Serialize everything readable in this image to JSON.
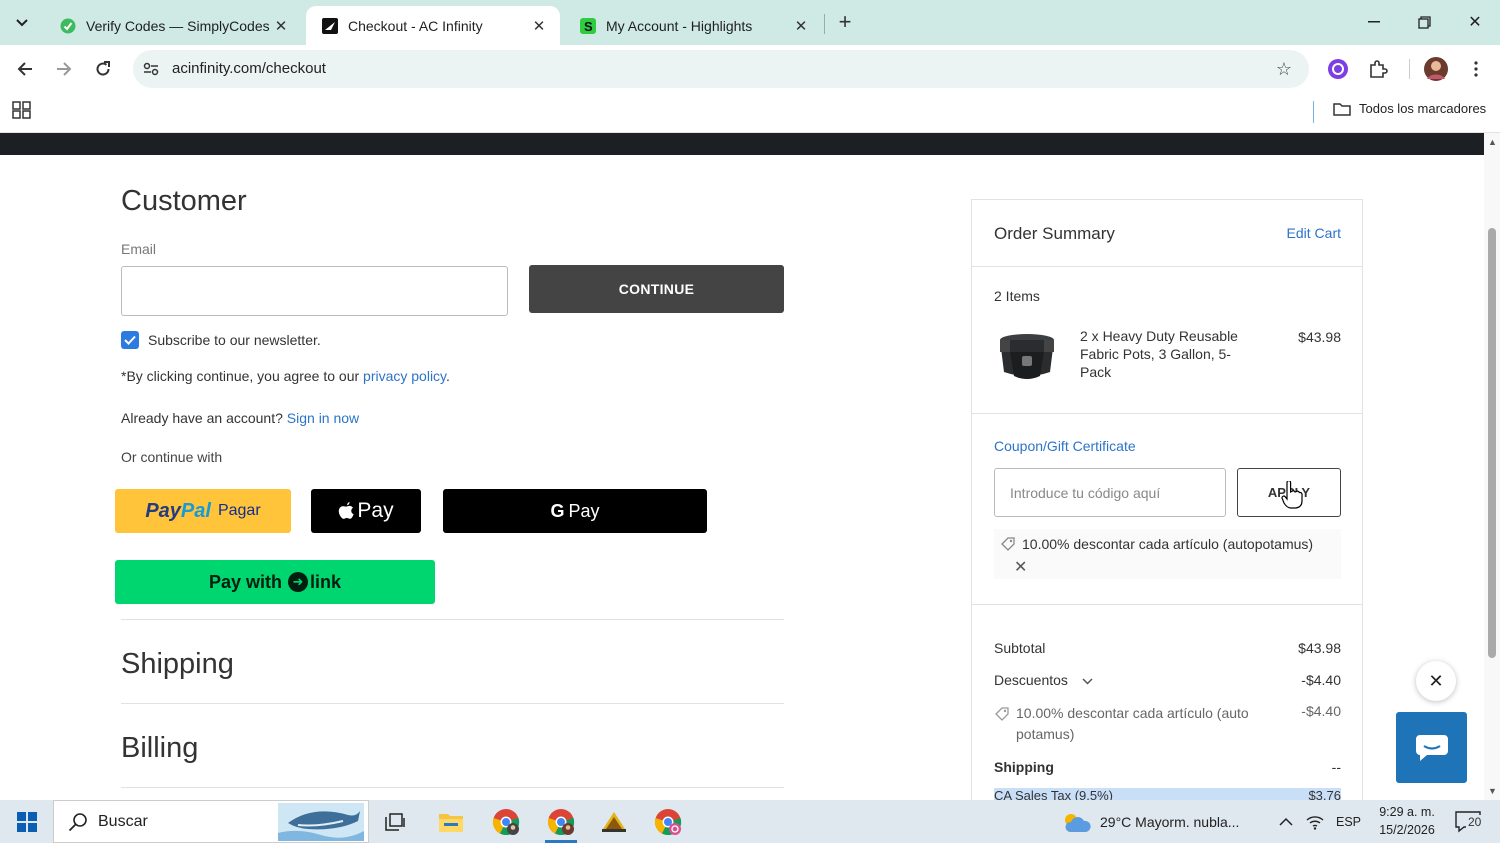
{
  "browser": {
    "tabs": [
      {
        "title": "Verify Codes — SimplyCodes",
        "icon": "simplycodes-icon"
      },
      {
        "title": "Checkout - AC Infinity",
        "icon": "acinfinity-icon",
        "active": true
      },
      {
        "title": "My Account - Highlights",
        "icon": "simplycodes-s-icon"
      }
    ],
    "url": "acinfinity.com/checkout",
    "bookmarks_all": "Todos los marcadores"
  },
  "customer": {
    "title": "Customer",
    "email_label": "Email",
    "email_value": "",
    "continue_label": "CONTINUE",
    "newsletter_label": "Subscribe to our newsletter.",
    "newsletter_checked": true,
    "policy_prefix": "*By clicking continue, you agree to our ",
    "policy_link": "privacy policy",
    "policy_suffix": ".",
    "account_prefix": "Already have an account? ",
    "account_link": "Sign in now",
    "or_continue": "Or continue with",
    "paypal_label": "Pagar",
    "paypal_brand_1": "Pay",
    "paypal_brand_2": "Pal",
    "apple_pay_label": "Pay",
    "google_pay_label": "Pay",
    "google_pay_g": "G",
    "link_prefix": "Pay with",
    "link_brand": "link"
  },
  "shipping": {
    "title": "Shipping"
  },
  "billing": {
    "title": "Billing"
  },
  "summary": {
    "title": "Order Summary",
    "edit_cart": "Edit Cart",
    "items_count": "2 Items",
    "product_name": "2 x Heavy Duty Reusable Fabric Pots, 3 Gallon, 5-Pack",
    "product_price": "$43.98",
    "coupon_label": "Coupon/Gift Certificate",
    "coupon_placeholder": "Introduce tu código aquí",
    "apply_label": "APPLY",
    "applied_coupon": "10.00% descontar cada artículo (autopotamus)",
    "subtotal_label": "Subtotal",
    "subtotal_value": "$43.98",
    "discounts_label": "Descuentos",
    "discounts_value": "-$4.40",
    "discount_detail_label": "10.00% descontar cada artículo (auto potamus)",
    "discount_detail_value": "-$4.40",
    "shipping_label": "Shipping",
    "shipping_value": "--",
    "tax_label": "CA Sales Tax (9.5%)",
    "tax_value": "$3.76"
  },
  "taskbar": {
    "search_placeholder": "Buscar",
    "weather": "29°C  Mayorm. nubla...",
    "language": "ESP",
    "time": "9:29 a. m.",
    "date": "15/2/2026",
    "notifications": "20"
  },
  "colors": {
    "tabbar_bg": "#cfe9e5",
    "link": "#2d73c8",
    "continue_bg": "#444444",
    "paypal_bg": "#ffc439",
    "link_pay_bg": "#00d66f",
    "chat_bg": "#1f73b7"
  }
}
